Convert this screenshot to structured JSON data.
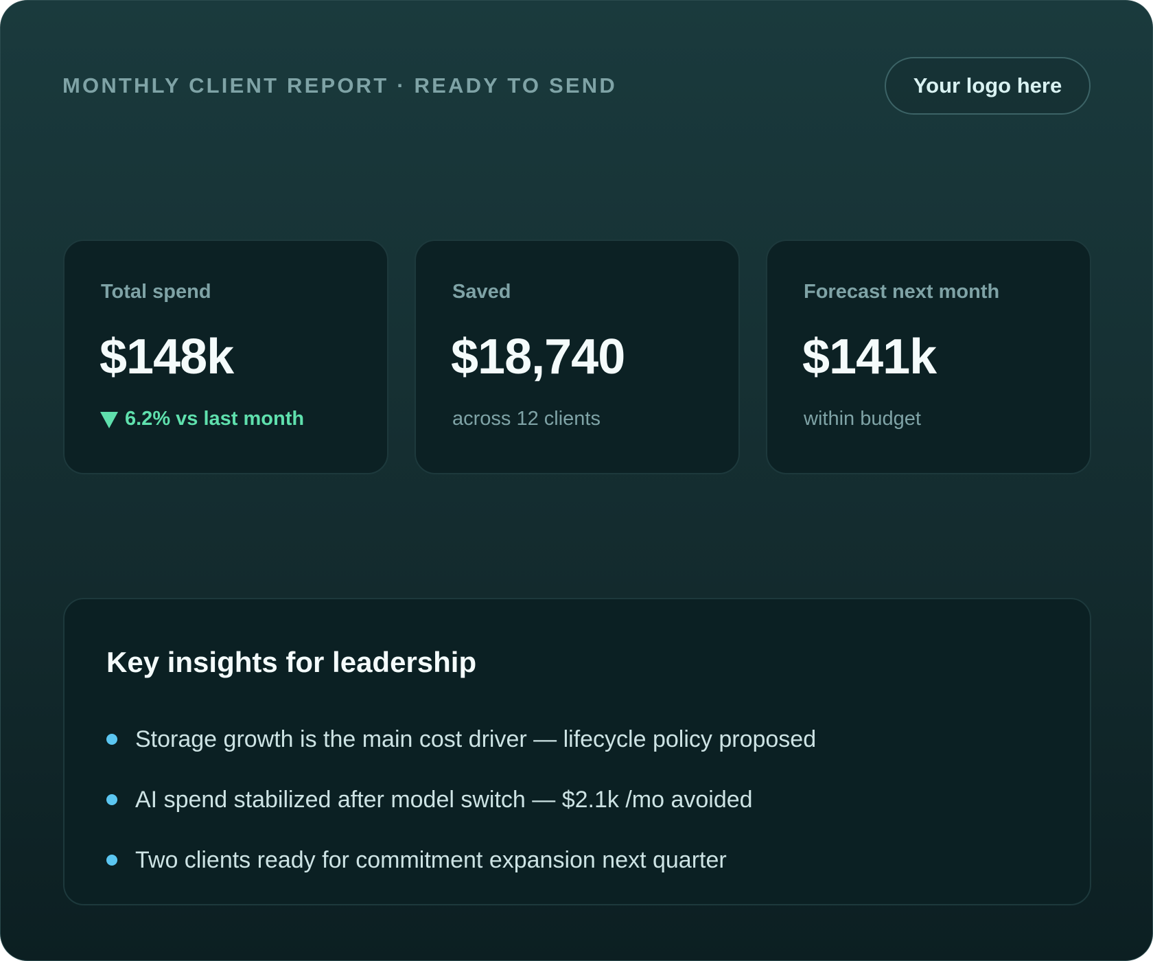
{
  "header": {
    "eyebrow": "MONTHLY CLIENT REPORT · READY TO SEND",
    "logo_label": "Your logo here"
  },
  "metrics": [
    {
      "label": "Total spend",
      "value": "$148k",
      "sub": "6.2% vs last month",
      "trend": "down"
    },
    {
      "label": "Saved",
      "value": "$18,740",
      "sub": "across 12 clients"
    },
    {
      "label": "Forecast next month",
      "value": "$141k",
      "sub": "within budget"
    }
  ],
  "insights": {
    "title": "Key insights for leadership",
    "items": [
      "Storage growth is the main cost driver — lifecycle policy proposed",
      "AI spend stabilized after model switch — $2.1k /mo avoided",
      "Two clients ready for commitment expansion next quarter"
    ]
  },
  "colors": {
    "accent_green": "#5fe0ad",
    "accent_blue": "#5bc6f1",
    "muted_text": "#7fa3a6",
    "primary_text": "#f4fbfb"
  }
}
